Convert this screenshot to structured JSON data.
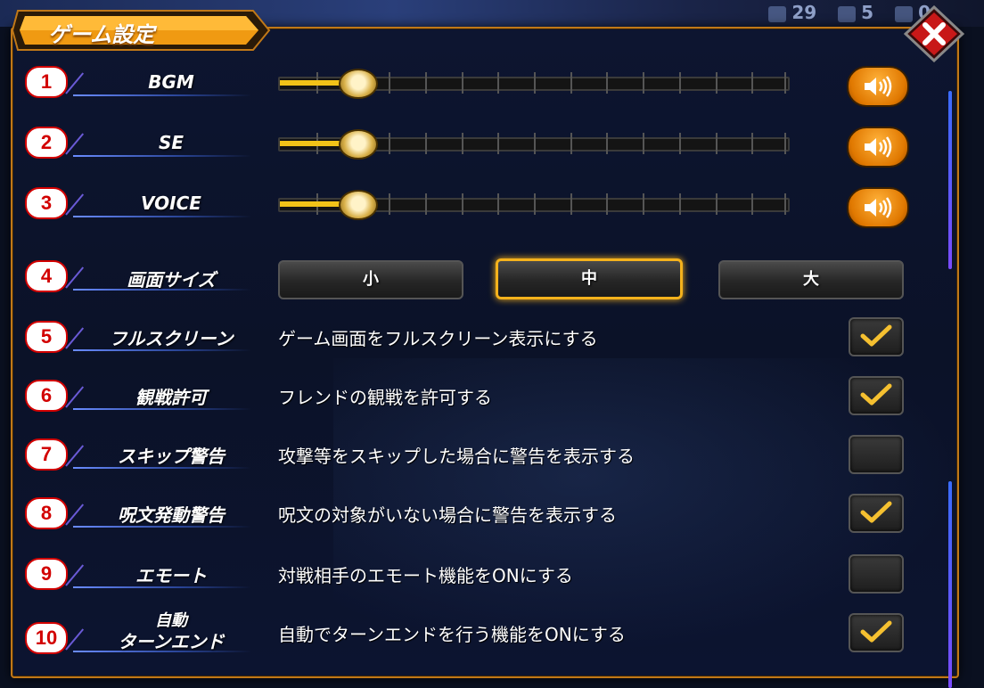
{
  "panel": {
    "title": "ゲーム設定",
    "close_label": "×"
  },
  "background_stats": [
    "29",
    "5",
    "0"
  ],
  "sliders": [
    {
      "number": "1",
      "label": "BGM",
      "value_fraction": 0.15
    },
    {
      "number": "2",
      "label": "SE",
      "value_fraction": 0.15
    },
    {
      "number": "3",
      "label": "VOICE",
      "value_fraction": 0.15
    }
  ],
  "screen_size": {
    "number": "4",
    "label": "画面サイズ",
    "options": [
      "小",
      "中",
      "大"
    ],
    "selected": "中"
  },
  "toggles": [
    {
      "number": "5",
      "label": "フルスクリーン",
      "description": "ゲーム画面をフルスクリーン表示にする",
      "checked": true
    },
    {
      "number": "6",
      "label": "観戦許可",
      "description": "フレンドの観戦を許可する",
      "checked": true
    },
    {
      "number": "7",
      "label": "スキップ警告",
      "description": "攻撃等をスキップした場合に警告を表示する",
      "checked": false
    },
    {
      "number": "8",
      "label": "呪文発動警告",
      "description": "呪文の対象がいない場合に警告を表示する",
      "checked": true
    },
    {
      "number": "9",
      "label": "エモート",
      "description": "対戦相手のエモート機能をONにする",
      "checked": false
    },
    {
      "number": "10",
      "label_line1": "自動",
      "label_line2": "ターンエンド",
      "description": "自動でターンエンドを行う機能をONにする",
      "checked": true
    }
  ],
  "colors": {
    "accent": "#f5b21c",
    "badge_border": "#d20000",
    "panel_border": "#c07818",
    "slider_fill": "#f2c318"
  }
}
